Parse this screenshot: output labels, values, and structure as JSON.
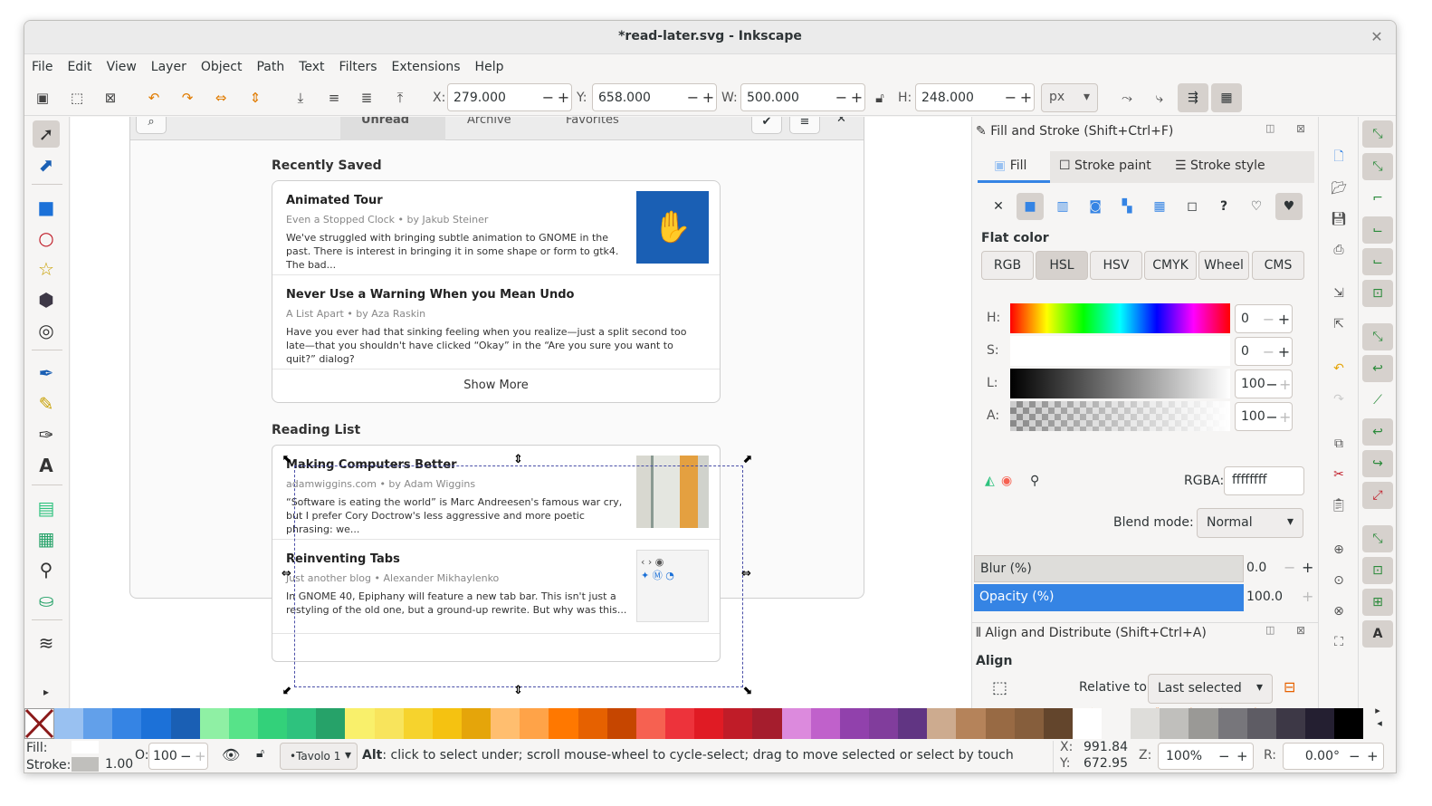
{
  "window": {
    "title": "*read-later.svg - Inkscape"
  },
  "menu": [
    "File",
    "Edit",
    "View",
    "Layer",
    "Object",
    "Path",
    "Text",
    "Filters",
    "Extensions",
    "Help"
  ],
  "toolbar": {
    "x_label": "X:",
    "x_value": "279.000",
    "y_label": "Y:",
    "y_value": "658.000",
    "w_label": "W:",
    "w_value": "500.000",
    "h_label": "H:",
    "h_value": "248.000",
    "unit": "px"
  },
  "canvas": {
    "tabs": [
      "Unread",
      "Archive",
      "Favorites"
    ],
    "recently_saved": {
      "title": "Recently Saved",
      "items": [
        {
          "title": "Animated Tour",
          "meta": "Even a Stopped Clock  •  by Jakub Steiner",
          "desc": "We've struggled with bringing subtle animation to GNOME in the past. There is interest in bringing it in some shape or form to gtk4. The bad..."
        },
        {
          "title": "Never Use a Warning When you Mean Undo",
          "meta": "A List Apart  •  by Aza Raskin",
          "desc": "Have you ever had that sinking feeling when you realize—just a split second too late—that you shouldn't have clicked “Okay” in the “Are you sure you want to quit?” dialog?"
        }
      ],
      "show_more": "Show More"
    },
    "reading_list": {
      "title": "Reading List",
      "items": [
        {
          "title": "Making Computers Better",
          "meta": "adamwiggins.com  •  by Adam Wiggins",
          "desc": "“Software is eating the world” is Marc Andreesen's famous war cry, but I prefer Cory Doctrow's less aggressive and more poetic phrasing: we..."
        },
        {
          "title": "Reinventing Tabs",
          "meta": "Just another blog  •  Alexander Mikhaylenko",
          "desc": "In GNOME 40, Epiphany will feature a new tab bar. This isn't just a restyling of the old one, but a ground-up rewrite. But why was this..."
        }
      ]
    }
  },
  "fill_stroke": {
    "title": "Fill and Stroke (Shift+Ctrl+F)",
    "tabs": [
      "Fill",
      "Stroke paint",
      "Stroke style"
    ],
    "flat_color": "Flat color",
    "modes": [
      "RGB",
      "HSL",
      "HSV",
      "CMYK",
      "Wheel",
      "CMS"
    ],
    "active_mode": "HSL",
    "h_label": "H:",
    "h_value": "0",
    "s_label": "S:",
    "s_value": "0",
    "l_label": "L:",
    "l_value": "100",
    "a_label": "A:",
    "a_value": "100",
    "rgba_label": "RGBA:",
    "rgba_value": "ffffffff",
    "blend_label": "Blend mode:",
    "blend_value": "Normal",
    "blur_label": "Blur (%)",
    "blur_value": "0.0",
    "opacity_label": "Opacity (%)",
    "opacity_value": "100.0"
  },
  "align": {
    "title": "Align and Distribute (Shift+Ctrl+A)",
    "heading": "Align",
    "relative_label": "Relative to:",
    "relative_value": "Last selected"
  },
  "palette_colors": [
    "#99c1f1",
    "#62a0ea",
    "#3584e4",
    "#1c71d8",
    "#1a5fb4",
    "#8ff0a4",
    "#57e389",
    "#33d17a",
    "#2ec27e",
    "#26a269",
    "#f9f06b",
    "#f8e45c",
    "#f6d32d",
    "#f5c211",
    "#e5a50a",
    "#ffbe6f",
    "#ffa348",
    "#ff7800",
    "#e66100",
    "#c64600",
    "#f66151",
    "#ed333b",
    "#e01b24",
    "#c01c28",
    "#a51d2d",
    "#dc8add",
    "#c061cb",
    "#9141ac",
    "#813d9c",
    "#613583",
    "#cdab8f",
    "#b5835a",
    "#986a44",
    "#865e3c",
    "#63452c",
    "#ffffff",
    "#f6f5f4",
    "#deddda",
    "#c0bfbc",
    "#9a9996",
    "#77767b",
    "#5e5c64",
    "#3d3846",
    "#241f31",
    "#000000"
  ],
  "status": {
    "fill_label": "Fill:",
    "stroke_label": "Stroke:",
    "stroke_width": "1.00",
    "opacity_label": "O:",
    "opacity_value": "100",
    "layer": "•Tavolo 1",
    "hint_key": "Alt",
    "hint": ": click to select under; scroll mouse-wheel to cycle-select; drag to move selected or select by touch",
    "cursor_x_label": "X:",
    "cursor_x": "991.84",
    "cursor_y_label": "Y:",
    "cursor_y": "672.95",
    "zoom_label": "Z:",
    "zoom": "100%",
    "rotate_label": "R:",
    "rotate": "0.00°"
  }
}
